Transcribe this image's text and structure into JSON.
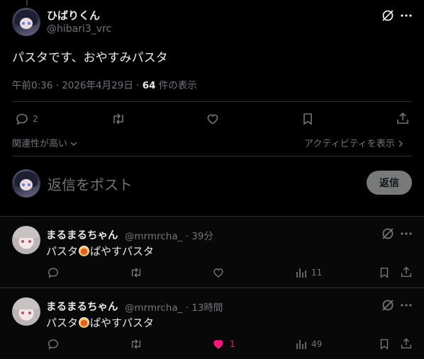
{
  "post": {
    "author_name": "ひばりくん",
    "author_handle": "@hibari3_vrc",
    "text": "パスタです、おやすみパスタ",
    "time": "午前0:36 · 2026年4月29日 · ",
    "views_count": "64",
    "views_label": " 件の表示",
    "reply_count": "2",
    "related_label": "関連性が高い",
    "activity_label": "アクティビティを表示"
  },
  "composer": {
    "placeholder": "返信をポスト",
    "reply_button": "返信"
  },
  "replies": [
    {
      "name": "まるまるちゃん",
      "handle": "@mrmrcha_",
      "time": "· 39分",
      "text_before": "パスタ",
      "text_after": "ぱやすパスタ",
      "like_count": "",
      "view_count": "11",
      "liked": false
    },
    {
      "name": "まるまるちゃん",
      "handle": "@mrmrcha_",
      "time": "· 13時間",
      "text_before": "パスタ",
      "text_after": "ぱやすパスタ",
      "like_count": "1",
      "view_count": "49",
      "liked": true
    }
  ],
  "colors": {
    "background": "#000000",
    "text": "#e7e9ea",
    "muted": "#71767b",
    "like_active": "#f91880",
    "reply_button_bg": "#787a7a"
  },
  "icons": [
    "reply-icon",
    "repost-icon",
    "like-icon",
    "bookmark-icon",
    "share-icon",
    "grok-icon",
    "more-icon",
    "views-icon",
    "chevron-down-icon",
    "chevron-right-icon",
    "pasta-emoji"
  ]
}
